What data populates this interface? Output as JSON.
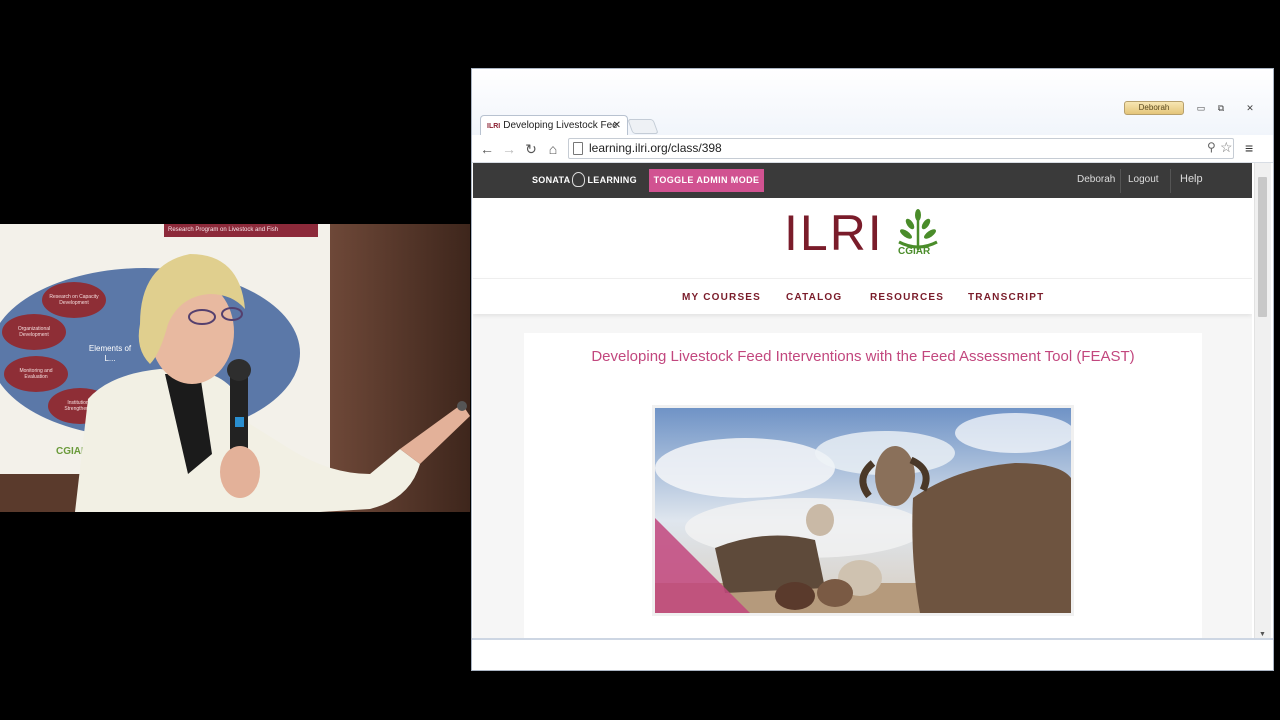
{
  "poster": {
    "header": "Research Program on Livestock and Fish",
    "nodes": [
      "Research on Capacity Development",
      "Organizational Development",
      "Monitoring and Evaluation",
      "Institutional Strengthening",
      "Elements of L..."
    ],
    "logo": "CGIAR"
  },
  "browser": {
    "user_chip": "Deborah",
    "tab_favicon": "ILRI",
    "tab_title": "Developing Livestock Fee",
    "tab_close": "✕",
    "url": "learning.ilri.org/class/398",
    "win_minimize": "▭",
    "win_restore": "⧉",
    "win_close": "✕",
    "icons": {
      "back": "←",
      "forward": "→",
      "reload": "↻",
      "home": "⌂",
      "zoom": "⚲",
      "star": "☆",
      "menu": "≡"
    }
  },
  "site": {
    "brand_left": "SONATA",
    "brand_right": "LEARNING",
    "admin_toggle": "TOGGLE ADMIN MODE",
    "user": "Deborah",
    "logout": "Logout",
    "help": "Help",
    "logo_text": "ILRI",
    "partner_logo": "CGIAR",
    "nav": [
      "MY COURSES",
      "CATALOG",
      "RESOURCES",
      "TRANSCRIPT"
    ],
    "course_title": "Developing Livestock Feed Interventions with the Feed Assessment Tool (FEAST)"
  },
  "colors": {
    "brand_maroon": "#7a1c2a",
    "accent_pink": "#d15291",
    "title_pink": "#c2477e",
    "header_dark": "#3a3a3a",
    "cgiar_green": "#4a8c2a"
  }
}
